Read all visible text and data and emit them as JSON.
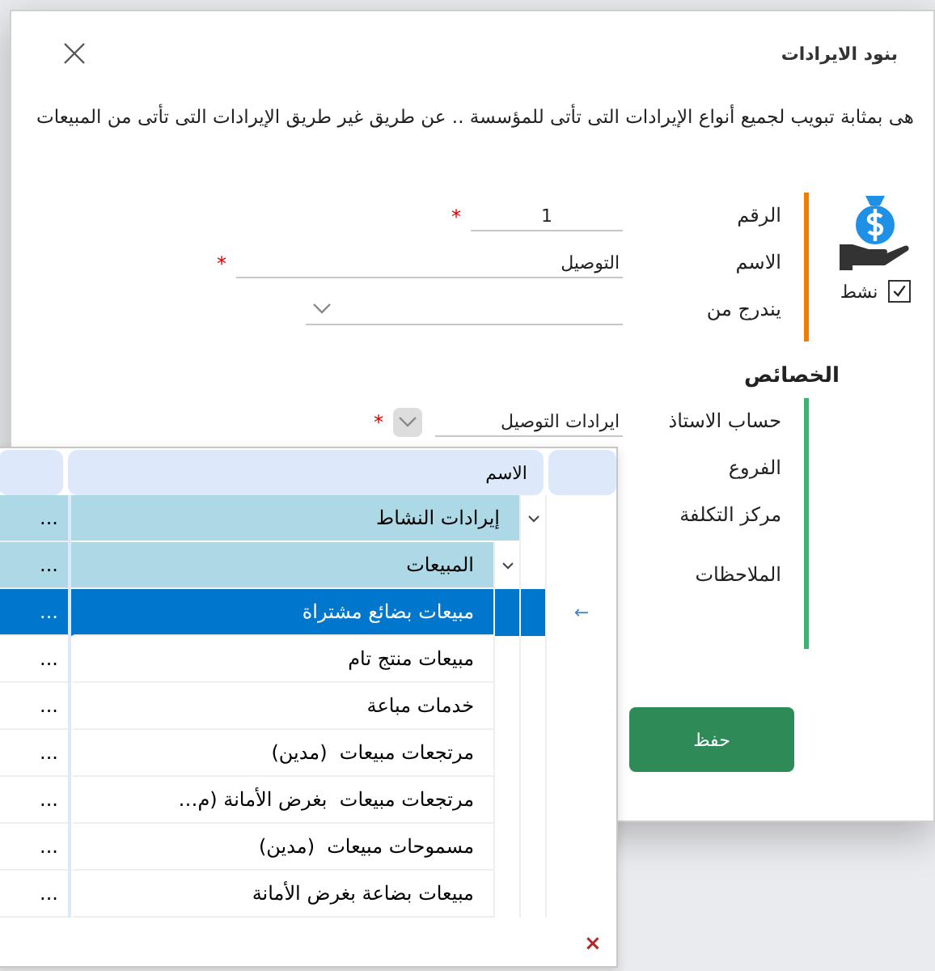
{
  "dialog": {
    "title": "بنود الايرادات",
    "description": "هى بمثابة تبويب لجميع أنواع الإيرادات التى تأتى للمؤسسة .. عن طريق غير طريق الإيرادات التى تأتى من المبيعات",
    "active": {
      "label": "نشط",
      "checked": true
    },
    "fields": [
      {
        "kind": "number",
        "label": "الرقم",
        "value": "1",
        "required_mark": "*"
      },
      {
        "kind": "text",
        "label": "الاسم",
        "value": "التوصيل",
        "required_mark": "*"
      },
      {
        "kind": "select",
        "label": "يندرج من"
      }
    ],
    "properties": {
      "title": "الخصائص",
      "fields": [
        {
          "kind": "lookup",
          "label": "حساب الاستاذ",
          "value": "ايرادات التوصيل",
          "required_mark": "*"
        },
        {
          "kind": "label",
          "label": "الفروع"
        },
        {
          "kind": "label",
          "label": "مركز التكلفة"
        },
        {
          "kind": "label",
          "label": "الملاحظات"
        }
      ]
    },
    "save_button": "حفظ"
  },
  "lookup_grid": {
    "columns": [
      "الاسم"
    ],
    "row_marker": "←",
    "clear_button": "×",
    "rows": [
      {
        "name": "إيرادات النشاط",
        "column_2": "...",
        "expanded": true,
        "selected": false,
        "children": [
          {
            "name": "المبيعات",
            "column_2": "...",
            "expanded": true,
            "selected": false,
            "children": [
              {
                "name": "مبيعات بضائع مشتراة",
                "column_2": "...",
                "selected": true
              },
              {
                "name": "مبيعات منتج تام",
                "column_2": "...",
                "selected": false
              },
              {
                "name": "خدمات مباعة",
                "column_2": "...",
                "selected": false
              },
              {
                "name": "مرتجعات مبيعات  (مدين)",
                "column_2": "...",
                "selected": false
              },
              {
                "name": "مرتجعات مبيعات  بغرض الأمانة (م…",
                "column_2": "...",
                "selected": false
              },
              {
                "name": "مسموحات مبيعات  (مدين)",
                "column_2": "...",
                "selected": false
              },
              {
                "name": "مبيعات بضاعة بغرض الأمانة",
                "column_2": "...",
                "selected": false
              }
            ]
          }
        ]
      }
    ]
  }
}
